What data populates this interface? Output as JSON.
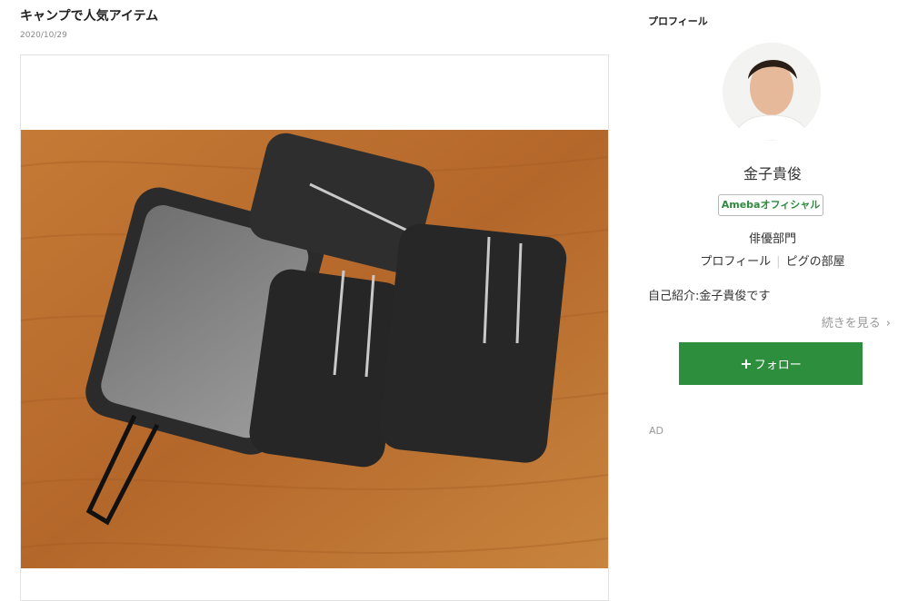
{
  "article": {
    "title": "キャンプで人気アイテム",
    "date": "2020/10/29"
  },
  "photo": {
    "icon": "mess-tin-photo"
  },
  "profile": {
    "heading": "プロフィール",
    "name": "金子貴俊",
    "badge": "Amebaオフィシャル",
    "category": "俳優部門",
    "links": [
      "プロフィール",
      "ピグの部屋"
    ],
    "intro": "自己紹介:金子貴俊です",
    "more_label": "続きを見る",
    "follow_plus": "+",
    "follow_label": "フォロー"
  },
  "ad_label": "AD",
  "colors": {
    "follow_button": "#2d8f3e",
    "badge_text": "#2e8b3d",
    "wood": "#b76a2c"
  }
}
